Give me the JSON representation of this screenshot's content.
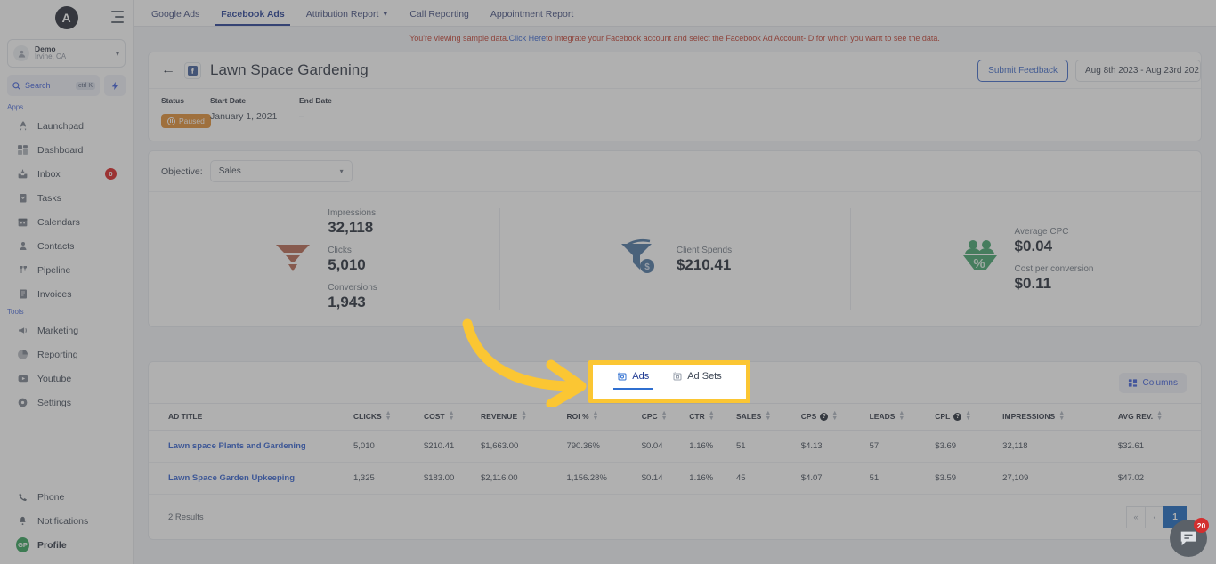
{
  "sidebar": {
    "brand_initial": "A",
    "account": {
      "name": "Demo",
      "location": "Irvine, CA"
    },
    "search": {
      "label": "Search",
      "shortcut": "ctrl K"
    },
    "section_apps": "Apps",
    "section_tools": "Tools",
    "apps": [
      {
        "label": "Launchpad",
        "icon": "rocket-icon",
        "badge": ""
      },
      {
        "label": "Dashboard",
        "icon": "dashboard-icon",
        "badge": ""
      },
      {
        "label": "Inbox",
        "icon": "inbox-icon",
        "badge": "0"
      },
      {
        "label": "Tasks",
        "icon": "tasks-icon",
        "badge": ""
      },
      {
        "label": "Calendars",
        "icon": "calendar-icon",
        "badge": ""
      },
      {
        "label": "Contacts",
        "icon": "contacts-icon",
        "badge": ""
      },
      {
        "label": "Pipeline",
        "icon": "pipeline-icon",
        "badge": ""
      },
      {
        "label": "Invoices",
        "icon": "invoices-icon",
        "badge": ""
      }
    ],
    "tools": [
      {
        "label": "Marketing",
        "icon": "megaphone-icon"
      },
      {
        "label": "Reporting",
        "icon": "pie-chart-icon"
      },
      {
        "label": "Youtube",
        "icon": "youtube-icon"
      },
      {
        "label": "Settings",
        "icon": "gear-icon"
      }
    ],
    "footer": [
      {
        "label": "Phone",
        "icon": "phone-icon"
      },
      {
        "label": "Notifications",
        "icon": "bell-icon"
      },
      {
        "label": "Profile",
        "icon": "avatar",
        "initials": "GP"
      }
    ]
  },
  "topnav": {
    "tabs": [
      {
        "label": "Google Ads",
        "active": false,
        "caret": false
      },
      {
        "label": "Facebook Ads",
        "active": true,
        "caret": false
      },
      {
        "label": "Attribution Report",
        "active": false,
        "caret": true
      },
      {
        "label": "Call Reporting",
        "active": false,
        "caret": false
      },
      {
        "label": "Appointment Report",
        "active": false,
        "caret": false
      }
    ]
  },
  "notice": {
    "prefix": "You're viewing sample data. ",
    "link": "Click Here",
    "suffix": " to integrate your Facebook account and select the Facebook Ad Account-ID for which you want to see the data."
  },
  "header": {
    "back_icon": "back-arrow-icon",
    "platform_icon": "facebook-icon",
    "title": "Lawn Space Gardening",
    "submit_feedback": "Submit Feedback",
    "date_range": "Aug 8th 2023 - Aug 23rd 202"
  },
  "meta": {
    "status_label": "Status",
    "status_value": "Paused",
    "start_label": "Start Date",
    "start_value": "January 1, 2021",
    "end_label": "End Date",
    "end_value": "–"
  },
  "objective": {
    "label": "Objective:",
    "value": "Sales"
  },
  "metrics": [
    {
      "icon": "funnel-icon",
      "items": [
        {
          "label": "Impressions",
          "value": "32,118"
        },
        {
          "label": "Clicks",
          "value": "5,010"
        },
        {
          "label": "Conversions",
          "value": "1,943"
        }
      ]
    },
    {
      "icon": "spend-funnel-dollar-icon",
      "items": [
        {
          "label": "Client Spends",
          "value": "$210.41"
        }
      ]
    },
    {
      "icon": "audience-percent-icon",
      "items": [
        {
          "label": "Average CPC",
          "value": "$0.04"
        },
        {
          "label": "Cost per conversion",
          "value": "$0.11"
        }
      ]
    }
  ],
  "subtabs": [
    {
      "label": "Ads",
      "icon": "ads-icon",
      "active": true
    },
    {
      "label": "Ad Sets",
      "icon": "ad-sets-icon",
      "active": false
    }
  ],
  "table": {
    "columns_button": "Columns",
    "headers": [
      {
        "label": "AD TITLE",
        "sortable": false,
        "info": false
      },
      {
        "label": "CLICKS",
        "sortable": true,
        "info": false
      },
      {
        "label": "COST",
        "sortable": true,
        "info": false
      },
      {
        "label": "REVENUE",
        "sortable": true,
        "info": false
      },
      {
        "label": "ROI %",
        "sortable": true,
        "info": false
      },
      {
        "label": "CPC",
        "sortable": true,
        "info": false
      },
      {
        "label": "CTR",
        "sortable": true,
        "info": false
      },
      {
        "label": "SALES",
        "sortable": true,
        "info": false
      },
      {
        "label": "CPS",
        "sortable": true,
        "info": true
      },
      {
        "label": "LEADS",
        "sortable": true,
        "info": false
      },
      {
        "label": "CPL",
        "sortable": true,
        "info": true
      },
      {
        "label": "IMPRESSIONS",
        "sortable": true,
        "info": false
      },
      {
        "label": "AVG REV.",
        "sortable": true,
        "info": false
      }
    ],
    "rows": [
      [
        "Lawn space Plants and Gardening",
        "5,010",
        "$210.41",
        "$1,663.00",
        "790.36%",
        "$0.04",
        "1.16%",
        "51",
        "$4.13",
        "57",
        "$3.69",
        "32,118",
        "$32.61"
      ],
      [
        "Lawn Space Garden Upkeeping",
        "1,325",
        "$183.00",
        "$2,116.00",
        "1,156.28%",
        "$0.14",
        "1.16%",
        "45",
        "$4.07",
        "51",
        "$3.59",
        "27,109",
        "$47.02"
      ]
    ],
    "results_text": "2 Results",
    "pager": {
      "first": "«",
      "prev": "‹",
      "current": "1"
    }
  },
  "chat": {
    "icon": "chat-bubble-icon",
    "badge": "20"
  },
  "colors": {
    "highlight": "#fbc633",
    "accent_blue": "#2f5ed0",
    "status_orange": "#e08a2e",
    "funnel_red": "#b4634d",
    "spend_blue": "#46719f",
    "audience_green": "#3fa36a",
    "notice_red": "#c0392b",
    "badge_red": "#d91c1c"
  }
}
